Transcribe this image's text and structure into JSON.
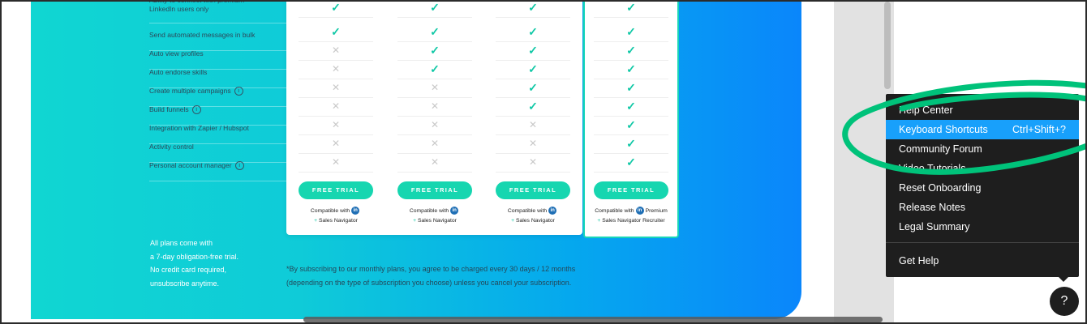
{
  "features": [
    {
      "label": "Ability to connect with premium LinkedIn users only",
      "info": false
    },
    {
      "label": "Send automated messages in bulk",
      "info": false
    },
    {
      "label": "Auto view profiles",
      "info": false
    },
    {
      "label": "Auto endorse skills",
      "info": false
    },
    {
      "label": "Create multiple campaigns",
      "info": true
    },
    {
      "label": "Build funnels",
      "info": true
    },
    {
      "label": "Integration with Zapier / Hubspot",
      "info": false
    },
    {
      "label": "Activity control",
      "info": false
    },
    {
      "label": "Personal account manager",
      "info": true
    }
  ],
  "plans": [
    {
      "cells": [
        "check",
        "check",
        "cross",
        "cross",
        "cross",
        "cross",
        "cross",
        "cross",
        "cross"
      ],
      "button": "FREE TRIAL",
      "compat_line1": "Compatible with",
      "compat_line2": "Sales Navigator",
      "compat_badge": "in",
      "compat_suffix": ""
    },
    {
      "cells": [
        "check",
        "check",
        "check",
        "check",
        "cross",
        "cross",
        "cross",
        "cross",
        "cross"
      ],
      "button": "FREE TRIAL",
      "compat_line1": "Compatible with",
      "compat_line2": "Sales Navigator",
      "compat_badge": "in",
      "compat_suffix": ""
    },
    {
      "cells": [
        "check",
        "check",
        "check",
        "check",
        "check",
        "check",
        "cross",
        "cross",
        "cross"
      ],
      "button": "FREE TRIAL",
      "compat_line1": "Compatible with",
      "compat_line2": "Sales Navigator",
      "compat_badge": "in",
      "compat_suffix": ""
    },
    {
      "cells": [
        "check",
        "check",
        "check",
        "check",
        "check",
        "check",
        "check",
        "check",
        "check"
      ],
      "button": "FREE TRIAL",
      "compat_line1": "Compatible with",
      "compat_line2": "Sales Navigator Recruiter",
      "compat_badge": "in",
      "compat_suffix": "Premium"
    }
  ],
  "plans_note": [
    "All plans come with",
    "a 7-day obligation-free trial.",
    "No credit card required,",
    "unsubscribe anytime."
  ],
  "subscription_note": [
    "*By subscribing to our monthly plans, you agree to be charged every 30 days / 12 months",
    "(depending on the type of subscription you choose) unless you cancel your subscription."
  ],
  "help_menu": {
    "items": [
      {
        "label": "Help Center",
        "shortcut": ""
      },
      {
        "label": "Keyboard Shortcuts",
        "shortcut": "Ctrl+Shift+?",
        "active": true
      },
      {
        "label": "Community Forum",
        "shortcut": ""
      },
      {
        "label": "Video Tutorials",
        "shortcut": ""
      },
      {
        "label": "Reset Onboarding",
        "shortcut": ""
      },
      {
        "label": "Release Notes",
        "shortcut": ""
      },
      {
        "label": "Legal Summary",
        "shortcut": ""
      }
    ],
    "footer_item": "Get Help",
    "help_button": "?"
  },
  "colors": {
    "accent": "#16d6b0",
    "menu_active": "#18a0fb",
    "annotation": "#00c27a"
  }
}
